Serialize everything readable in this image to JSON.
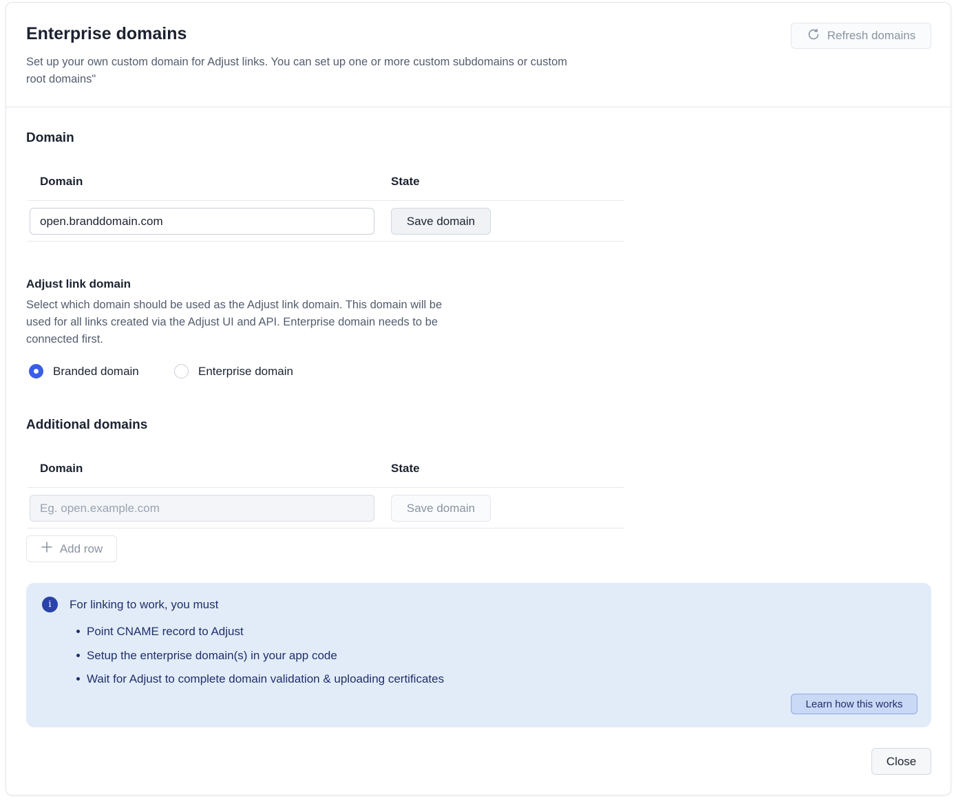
{
  "header": {
    "title": "Enterprise domains",
    "subtitle": "Set up your own custom domain for Adjust links. You can set up one or more custom subdomains or custom root domains\"",
    "refresh_label": "Refresh domains",
    "refresh_icon": "refresh-icon"
  },
  "domain_section": {
    "title": "Domain",
    "col_domain": "Domain",
    "col_state": "State",
    "input_value": "open.branddomain.com",
    "save_label": "Save domain"
  },
  "link_domain": {
    "title": "Adjust link domain",
    "description": "Select which domain should be used as the Adjust link domain. This domain will be used for all links created via the Adjust UI and API. Enterprise domain needs to be connected first.",
    "options": [
      {
        "label": "Branded domain",
        "checked": true
      },
      {
        "label": "Enterprise domain",
        "checked": false
      }
    ]
  },
  "additional_section": {
    "title": "Additional domains",
    "col_domain": "Domain",
    "col_state": "State",
    "input_placeholder": "Eg. open.example.com",
    "save_label": "Save domain",
    "add_row_label": "Add row"
  },
  "info": {
    "icon": "info-icon",
    "title": "For linking to work, you must",
    "items": [
      "Point CNAME record to Adjust",
      "Setup the enterprise domain(s) in your app code",
      "Wait for Adjust to complete domain validation & uploading certificates"
    ],
    "learn_label": "Learn how this works"
  },
  "footer": {
    "close_label": "Close"
  },
  "colors": {
    "accent": "#3a5ee6",
    "info_bg": "#e2ecf8",
    "info_text": "#1f2f6b"
  }
}
